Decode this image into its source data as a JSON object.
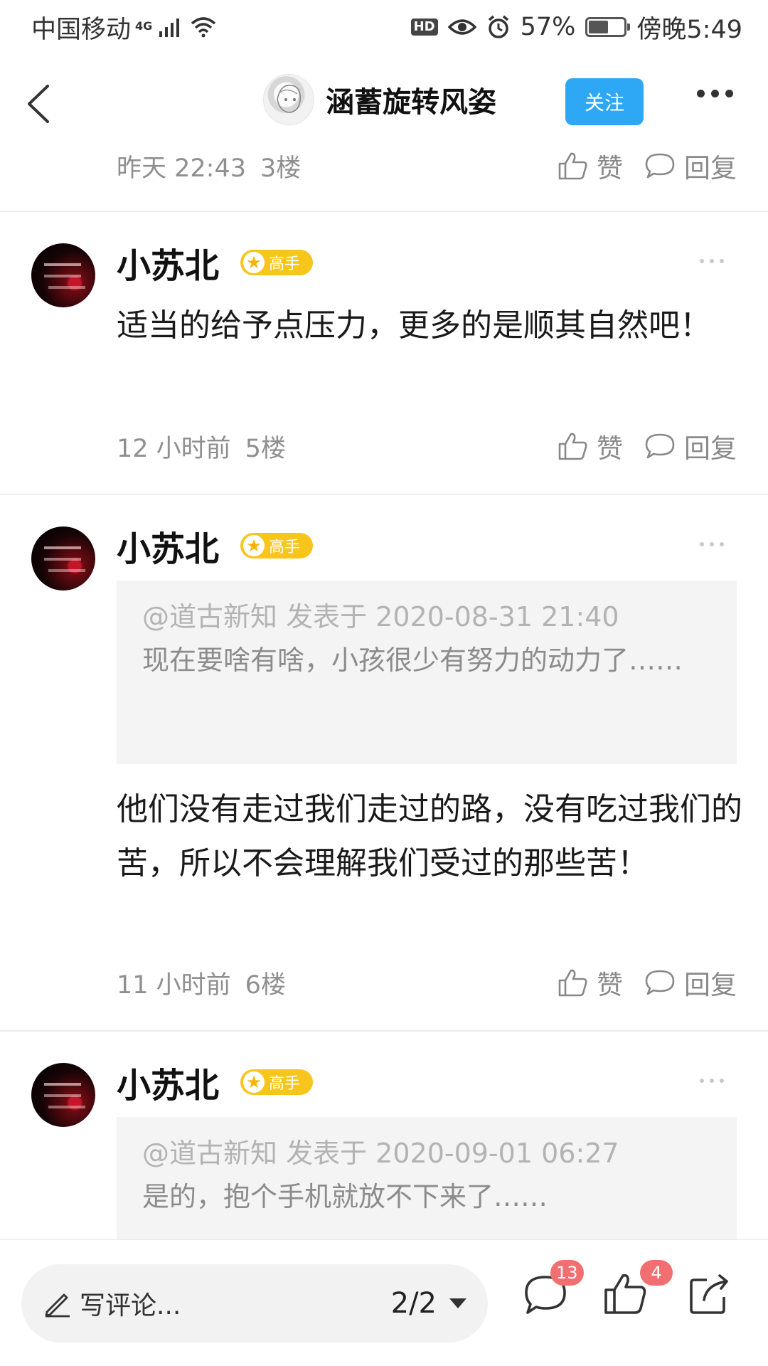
{
  "status_bar": {
    "carrier": "中国移动",
    "network": "4G",
    "battery_percent": "57%",
    "battery_level": 0.57,
    "time": "傍晚5:49",
    "hd_label": "HD"
  },
  "header": {
    "author_name": "涵蓄旋转风姿",
    "follow_label": "关注"
  },
  "floor3_meta": {
    "time": "昨天 22:43",
    "floor": "3楼",
    "like_label": "赞",
    "reply_label": "回复"
  },
  "posts": [
    {
      "username": "小苏北",
      "badge": "高手",
      "text": "适当的给予点压力，更多的是顺其自然吧！",
      "time": "12 小时前",
      "floor": "5楼",
      "like_label": "赞",
      "reply_label": "回复"
    },
    {
      "username": "小苏北",
      "badge": "高手",
      "quote_head": "@道古新知 发表于 2020-08-31 21:40",
      "quote_text": "现在要啥有啥，小孩很少有努力的动力了……",
      "text": "他们没有走过我们走过的路，没有吃过我们的苦，所以不会理解我们受过的那些苦！",
      "time": "11 小时前",
      "floor": "6楼",
      "like_label": "赞",
      "reply_label": "回复"
    },
    {
      "username": "小苏北",
      "badge": "高手",
      "quote_head": "@道古新知 发表于 2020-09-01 06:27",
      "quote_text": "是的，抱个手机就放不下来了……"
    }
  ],
  "bottom_bar": {
    "comment_placeholder": "写评论...",
    "page_indicator": "2/2",
    "comment_count": "13",
    "like_count": "4"
  }
}
